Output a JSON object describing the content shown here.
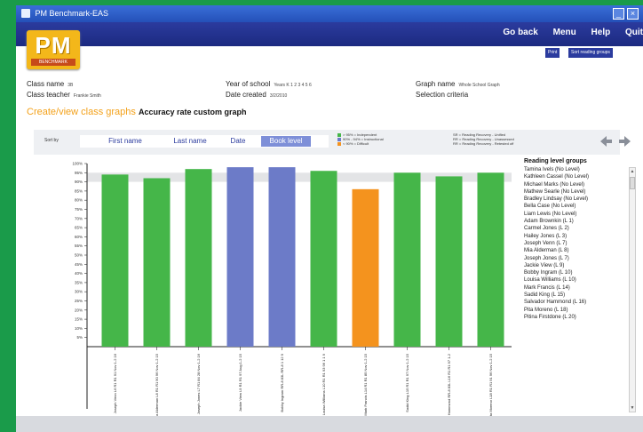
{
  "window": {
    "title": "PM Benchmark-EAS",
    "controls": [
      "_",
      "×"
    ]
  },
  "nav": {
    "links": [
      "Go back",
      "Menu",
      "Help",
      "Quit"
    ]
  },
  "logo": {
    "text": "PM",
    "sub": "BENCHMARK"
  },
  "toolbar": {
    "print": "Print",
    "sort": "Sort reading groups"
  },
  "info": {
    "class_name_label": "Class name",
    "class_name": "3B",
    "teacher_label": "Class teacher",
    "teacher": "Frankie Smith",
    "year_label": "Year of school",
    "year": "Years K 1 2 3 4 5 6",
    "date_label": "Date created",
    "date": "3/2/2010",
    "graph_label": "Graph name",
    "graph": "Whole School Graph",
    "selection_label": "Selection criteria"
  },
  "heading": {
    "part1": "Create/view class graphs",
    "part2": "Accuracy rate custom graph"
  },
  "sort": {
    "label": "Sort by",
    "buttons": [
      "First name",
      "Last name",
      "Date",
      "Book level"
    ],
    "active": "Book level"
  },
  "legend": {
    "col1": [
      {
        "text": "> 95% = Independent",
        "color": "#45b649"
      },
      {
        "text": "90% - 94% = Instructional",
        "color": "#6c7bc8"
      },
      {
        "text": "< 90% = Difficult",
        "color": "#f4931e"
      }
    ],
    "col2": [
      "SR = Reading Recovery - Unified",
      "RR = Reading Recovery - Unassessed",
      "RR = Reading Recovery - Retested off"
    ]
  },
  "reading_groups": {
    "title": "Reading level groups",
    "items": [
      "Tamina Ivels (No Level)",
      "Kathleen Cassel (No Level)",
      "Michael Marks (No Level)",
      "Mathew Searle (No Level)",
      "Bradley Lindsay (No Level)",
      "Bella Case (No Level)",
      "Liam Lewis (No Level)",
      "Adam Brownkin (L 1)",
      "Carmel Jones (L 2)",
      "Hailey Jones (L 3)",
      "Joseph Venn (L 7)",
      "Mia Alderman (L 8)",
      "Joseph Jones (L 7)",
      "Jackie View (L 9)",
      "Bobby Ingram (L 10)",
      "Louisa Williams (L 10)",
      "Mark Francis (L 14)",
      "Sadid King (L 15)",
      "Salvador Hammond (L 16)",
      "Pita Moreno (L 18)",
      "Pitina Firstdone (L 20)"
    ]
  },
  "chart_data": {
    "type": "bar",
    "ylim": [
      0,
      100
    ],
    "yticks": [
      "100%",
      "95%",
      "90%",
      "85%",
      "80%",
      "75%",
      "70%",
      "65%",
      "60%",
      "55%",
      "50%",
      "45%",
      "40%",
      "35%",
      "30%",
      "25%",
      "20%",
      "15%",
      "10%",
      "5%"
    ],
    "band": [
      90,
      95
    ],
    "categories": [
      "Joseph Venn L6 R1 R1 91 Nov 1-2 16",
      "Mia Alderman L8 R1 R1 90 96 Nov 1-2 15",
      "Joseph Jones L7 R1 84 28 Nov 1-2 16",
      "Jackie View L9 R1 R1 97 Aug 1-2 15",
      "Bobby Ingram RR-8 83L RR-8 1 12 9",
      "Louisa Williams L10 R1 R1 93 96 1 1 9",
      "Mark Francis L14 R1 R1 85 Nov 1-2 15",
      "Sadid King L15 R1 R1 97 Nov 1-2 15",
      "Salvador Hammond RR-8 83L L16 R1 R1 97 1-2",
      "Pita Moreno L18 R1 R1 91 96 Nov 1-2 15"
    ],
    "values": [
      94,
      92,
      97,
      98,
      98,
      96,
      86,
      95,
      93,
      95
    ],
    "colors": [
      "#45b649",
      "#45b649",
      "#45b649",
      "#6c7bc8",
      "#6c7bc8",
      "#45b649",
      "#f4931e",
      "#45b649",
      "#45b649",
      "#45b649"
    ]
  },
  "colors": {
    "independent": "#45b649",
    "instructional": "#6c7bc8",
    "difficult": "#f4931e",
    "nav": "#1c2a80"
  }
}
